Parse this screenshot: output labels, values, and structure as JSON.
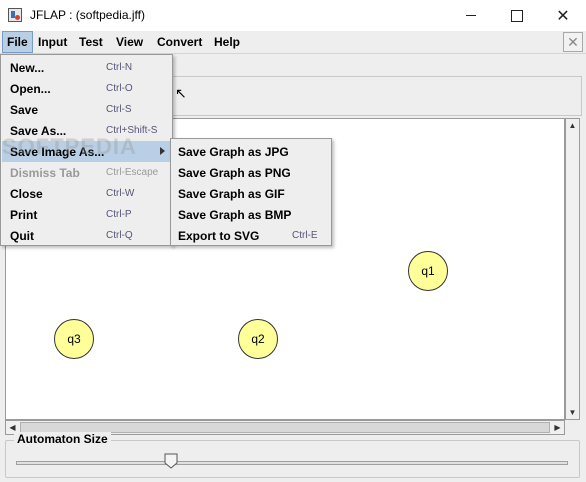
{
  "window": {
    "title": "JFLAP : (softpedia.jff)"
  },
  "menubar": {
    "items": [
      "File",
      "Input",
      "Test",
      "View",
      "Convert",
      "Help"
    ],
    "active": "File"
  },
  "file_menu": {
    "items": [
      {
        "label": "New...",
        "accel": "Ctrl-N",
        "enabled": true
      },
      {
        "label": "Open...",
        "accel": "Ctrl-O",
        "enabled": true
      },
      {
        "label": "Save",
        "accel": "Ctrl-S",
        "enabled": true
      },
      {
        "label": "Save As...",
        "accel": "Ctrl+Shift-S",
        "enabled": true
      },
      {
        "label": "Save Image As...",
        "accel": "",
        "enabled": true,
        "highlighted": true,
        "submenu": true
      },
      {
        "label": "Dismiss Tab",
        "accel": "Ctrl-Escape",
        "enabled": false
      },
      {
        "label": "Close",
        "accel": "Ctrl-W",
        "enabled": true
      },
      {
        "label": "Print",
        "accel": "Ctrl-P",
        "enabled": true
      },
      {
        "label": "Quit",
        "accel": "Ctrl-Q",
        "enabled": true
      }
    ]
  },
  "save_image_submenu": {
    "items": [
      {
        "label": "Save Graph as JPG",
        "accel": ""
      },
      {
        "label": "Save Graph as PNG",
        "accel": ""
      },
      {
        "label": "Save Graph as GIF",
        "accel": ""
      },
      {
        "label": "Save Graph as BMP",
        "accel": ""
      },
      {
        "label": "Export to SVG",
        "accel": "Ctrl-E"
      }
    ]
  },
  "watermark": "SOFTPEDIA",
  "states": [
    {
      "label": "q1"
    },
    {
      "label": "q2"
    },
    {
      "label": "q3"
    }
  ],
  "automaton_size": {
    "label": "Automaton Size",
    "value_fraction": 0.28
  },
  "colors": {
    "state_fill": "#ffff99",
    "menu_highlight": "#b8cfe5",
    "background": "#eeeeee"
  },
  "icons": {
    "close_tab": "close-icon",
    "submenu": "chevron-right-icon"
  }
}
